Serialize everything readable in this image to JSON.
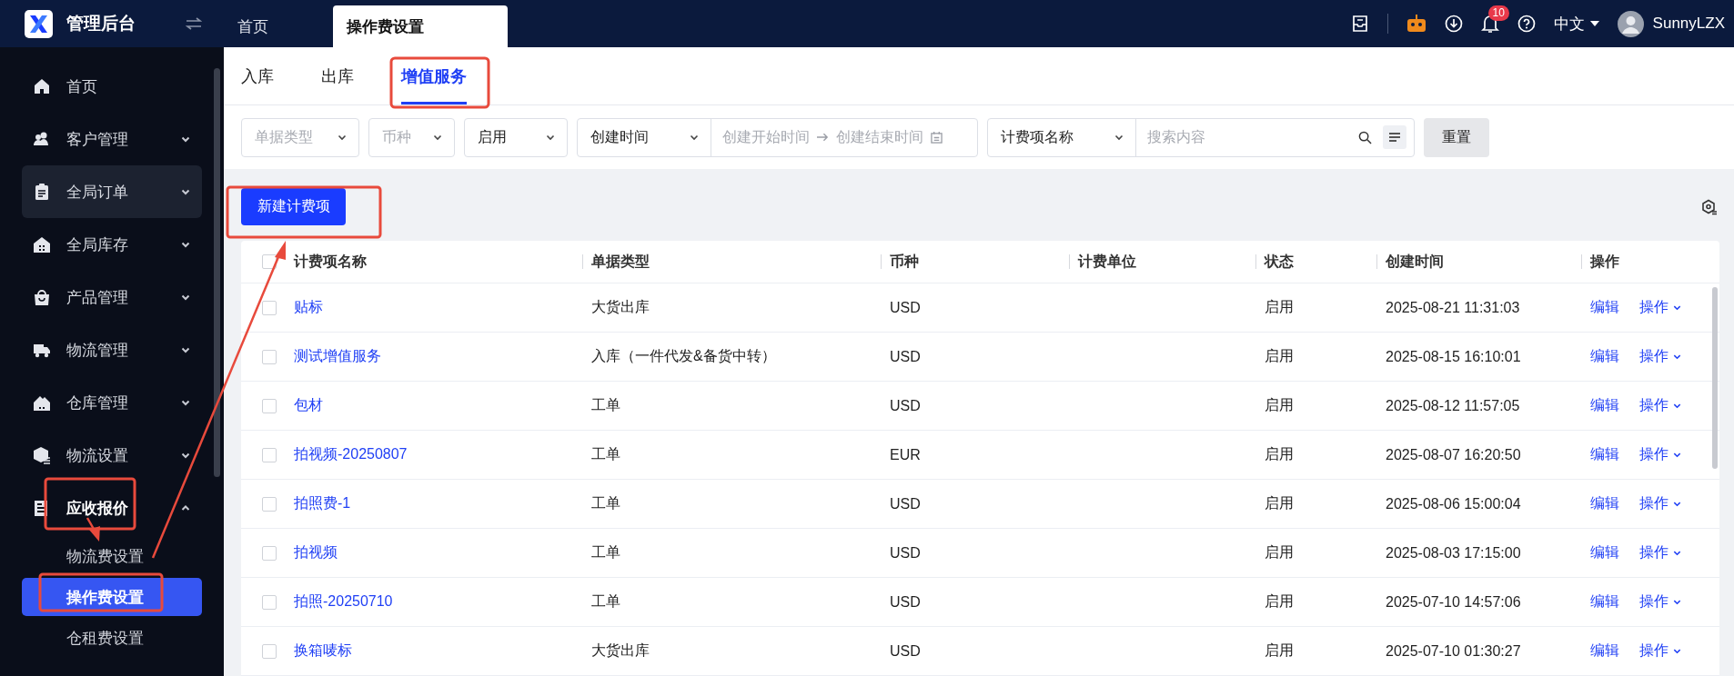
{
  "topbar": {
    "app_title": "管理后台",
    "tabs": [
      {
        "label": "首页",
        "selected": false
      },
      {
        "label": "操作费设置",
        "selected": true
      }
    ],
    "language": "中文",
    "notification_count": "10",
    "username": "SunnyLZX"
  },
  "sidebar": {
    "items": [
      {
        "label": "首页",
        "kind": "link",
        "highlighted": false
      },
      {
        "label": "客户管理",
        "kind": "group",
        "expanded": false,
        "highlighted": false
      },
      {
        "label": "全局订单",
        "kind": "group",
        "expanded": false,
        "highlighted": true
      },
      {
        "label": "全局库存",
        "kind": "group",
        "expanded": false,
        "highlighted": false
      },
      {
        "label": "产品管理",
        "kind": "group",
        "expanded": false,
        "highlighted": false
      },
      {
        "label": "物流管理",
        "kind": "group",
        "expanded": false,
        "highlighted": false
      },
      {
        "label": "仓库管理",
        "kind": "group",
        "expanded": false,
        "highlighted": false
      },
      {
        "label": "物流设置",
        "kind": "group",
        "expanded": false,
        "highlighted": false
      },
      {
        "label": "应收报价",
        "kind": "group",
        "expanded": true,
        "highlighted": false,
        "children": [
          {
            "label": "物流费设置",
            "selected": false
          },
          {
            "label": "操作费设置",
            "selected": true
          },
          {
            "label": "仓租费设置",
            "selected": false
          }
        ]
      }
    ]
  },
  "sub_tabs": [
    {
      "label": "入库",
      "selected": false
    },
    {
      "label": "出库",
      "selected": false
    },
    {
      "label": "增值服务",
      "selected": true
    }
  ],
  "filters": [
    {
      "kind": "select",
      "placeholder": "单据类型"
    },
    {
      "kind": "select",
      "placeholder": "币种"
    },
    {
      "kind": "select",
      "value": "启用"
    },
    {
      "kind": "date_range",
      "field": "创建时间",
      "start_placeholder": "创建开始时间",
      "end_placeholder": "创建结束时间"
    },
    {
      "kind": "search",
      "field": "计费项名称",
      "placeholder": "搜索内容"
    }
  ],
  "reset_button": "重置",
  "new_button": "新建计费项",
  "table": {
    "all_checked": false,
    "columns": [
      "计费项名称",
      "单据类型",
      "币种",
      "计费单位",
      "状态",
      "创建时间",
      "操作"
    ],
    "rows": [
      {
        "checked": false,
        "name": "贴标",
        "document_type": "大货出库",
        "currency": "USD",
        "status": "启用",
        "created_at": "2025-08-21 11:31:03",
        "edit": "编辑",
        "action": "操作"
      },
      {
        "checked": false,
        "name": "测试增值服务",
        "document_type": "入库（一件代发&备货中转）",
        "currency": "USD",
        "status": "启用",
        "created_at": "2025-08-15 16:10:01",
        "edit": "编辑",
        "action": "操作"
      },
      {
        "checked": false,
        "name": "包材",
        "document_type": "工单",
        "currency": "USD",
        "status": "启用",
        "created_at": "2025-08-12 11:57:05",
        "edit": "编辑",
        "action": "操作"
      },
      {
        "checked": false,
        "name": "拍视频-20250807",
        "document_type": "工单",
        "currency": "EUR",
        "status": "启用",
        "created_at": "2025-08-07 16:20:50",
        "edit": "编辑",
        "action": "操作"
      },
      {
        "checked": false,
        "name": "拍照费-1",
        "document_type": "工单",
        "currency": "USD",
        "status": "启用",
        "created_at": "2025-08-06 15:00:04",
        "edit": "编辑",
        "action": "操作"
      },
      {
        "checked": false,
        "name": "拍视频",
        "document_type": "工单",
        "currency": "USD",
        "status": "启用",
        "created_at": "2025-08-03 17:15:00",
        "edit": "编辑",
        "action": "操作"
      },
      {
        "checked": false,
        "name": "拍照-20250710",
        "document_type": "工单",
        "currency": "USD",
        "status": "启用",
        "created_at": "2025-07-10 14:57:06",
        "edit": "编辑",
        "action": "操作"
      },
      {
        "checked": false,
        "name": "换箱唛标",
        "document_type": "大货出库",
        "currency": "USD",
        "status": "启用",
        "created_at": "2025-07-10 01:30:27",
        "edit": "编辑",
        "action": "操作"
      }
    ]
  }
}
